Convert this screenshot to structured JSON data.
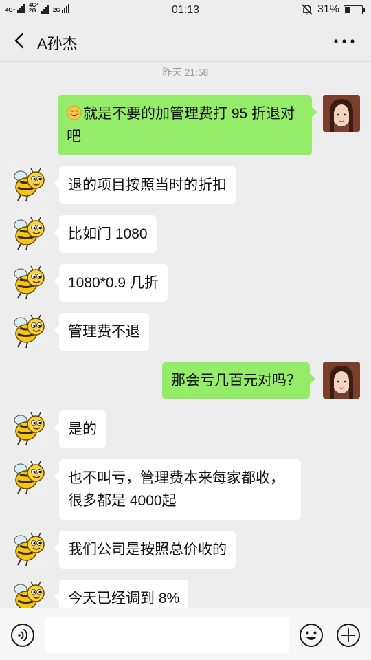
{
  "status_bar": {
    "network_1": "4G⁺",
    "network_2": "4G⁺ 2G",
    "network_3": "2G",
    "time": "01:13",
    "battery": "31%",
    "battery_level": 0.31
  },
  "header": {
    "title": "A孙杰",
    "back_icon": "chevron-left-icon",
    "more_icon": "more-dots-icon"
  },
  "chat": {
    "timestamp": "昨天 21:58",
    "messages": [
      {
        "side": "right",
        "emoji": "smile-emoji",
        "text": "就是不要的加管理费打 95 折退对吧"
      },
      {
        "side": "left",
        "text": "退的项目按照当时的折扣"
      },
      {
        "side": "left",
        "text": "比如门 1080"
      },
      {
        "side": "left",
        "text": "1080*0.9 几折"
      },
      {
        "side": "left",
        "text": "管理费不退"
      },
      {
        "side": "right",
        "text": "那会亏几百元对吗？"
      },
      {
        "side": "left",
        "text": "是的"
      },
      {
        "side": "left",
        "text": "也不叫亏，管理费本来每家都收，很多都是 4000起"
      },
      {
        "side": "left",
        "text": "我们公司是按照总价收的"
      },
      {
        "side": "left",
        "text": "今天已经调到 8%"
      }
    ]
  },
  "input_bar": {
    "voice_icon": "voice-icon",
    "input_value": "",
    "emoji_icon": "emoji-icon",
    "plus_icon": "plus-icon"
  },
  "colors": {
    "background": "#ededed",
    "bubble_self": "#95ec69",
    "bubble_other": "#ffffff"
  }
}
